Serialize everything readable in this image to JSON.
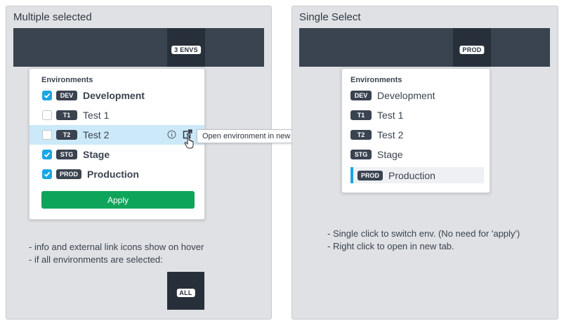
{
  "left_panel": {
    "title": "Multiple selected",
    "topbar_badge": "3 ENVS",
    "dropdown": {
      "header": "Environments",
      "items": [
        {
          "tag": "DEV",
          "label": "Development",
          "checked": true
        },
        {
          "tag": "T1",
          "label": "Test 1",
          "checked": false
        },
        {
          "tag": "T2",
          "label": "Test 2",
          "checked": false,
          "hovered": true
        },
        {
          "tag": "STG",
          "label": "Stage",
          "checked": true
        },
        {
          "tag": "PROD",
          "label": "Production",
          "checked": true
        }
      ],
      "apply_label": "Apply"
    },
    "tooltip": "Open environment in new tab",
    "notes": [
      "- info and external link icons show on hover",
      "- if all environments are selected:"
    ],
    "all_badge": "ALL"
  },
  "right_panel": {
    "title": "Single Select",
    "topbar_badge": "PROD",
    "dropdown": {
      "header": "Environments",
      "items": [
        {
          "tag": "DEV",
          "label": "Development"
        },
        {
          "tag": "T1",
          "label": "Test 1"
        },
        {
          "tag": "T2",
          "label": "Test 2"
        },
        {
          "tag": "STG",
          "label": "Stage"
        },
        {
          "tag": "PROD",
          "label": "Production",
          "selected": true
        }
      ]
    },
    "notes": [
      "- Single click to switch env. (No need for 'apply')",
      "- Right click to open in new tab."
    ]
  },
  "colors": {
    "accent": "#1aa6e4",
    "apply": "#0ea55a",
    "topbar": "#3a4350",
    "hover_row": "#cce9fa"
  }
}
